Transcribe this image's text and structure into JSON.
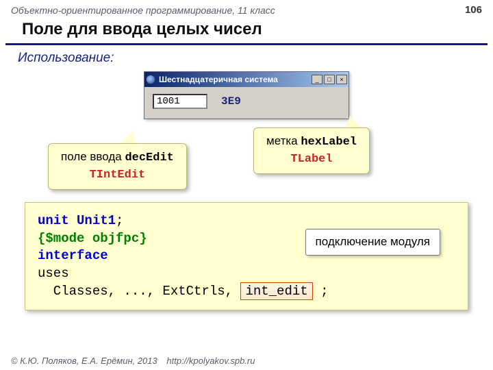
{
  "header": {
    "course": "Объектно-ориентированное программирование, 11 класс",
    "page": "106"
  },
  "title": "Поле для ввода целых чисел",
  "section": "Использование:",
  "window": {
    "caption": "Шестнадцатеричная система",
    "btn_min": "_",
    "btn_max": "□",
    "btn_close": "×",
    "input_value": "1001",
    "hex_value": "3E9"
  },
  "callout_left": {
    "line1": "поле ввода ",
    "mono": "decEdit",
    "type": "TIntEdit"
  },
  "callout_right": {
    "line1": "метка ",
    "mono": "hexLabel",
    "type": "TLabel"
  },
  "code": {
    "l1a": "unit ",
    "l1b": "Unit1",
    "l1c": ";",
    "l2": "{$mode objfpc}",
    "l3": "interface",
    "l4": "uses",
    "l5a": "  Classes, ..., ExtCtrls, ",
    "l5b": "int_edit",
    "l5c": " ;"
  },
  "code_callout": "подключение модуля",
  "footer": {
    "copyright": "© К.Ю. Поляков, Е.А. Ерёмин, 2013",
    "link": "http://kpolyakov.spb.ru"
  }
}
